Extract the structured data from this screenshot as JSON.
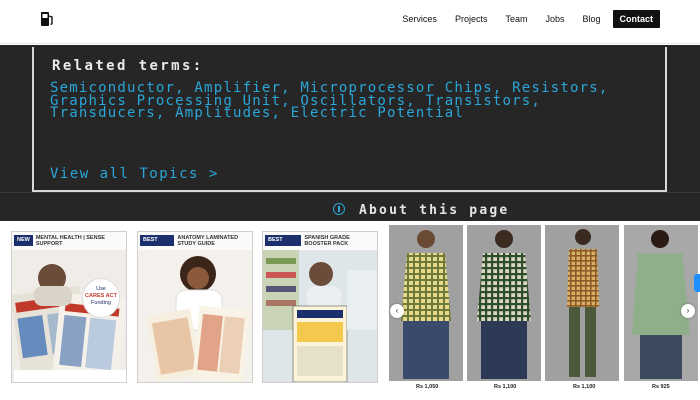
{
  "header": {
    "logo_icon": "fuel-pump-icon",
    "nav": [
      {
        "label": "Services"
      },
      {
        "label": "Projects"
      },
      {
        "label": "Team"
      },
      {
        "label": "Jobs"
      },
      {
        "label": "Blog"
      }
    ],
    "contact_label": "Contact"
  },
  "related": {
    "title": "Related terms:",
    "terms": "Semiconductor, Amplifier, Microprocessor Chips, Resistors, Graphics Processing Unit, Oscillators, Transistors, Transducers, Amplitudes, Electric Potential",
    "view_all": "View all Topics  >",
    "about": "About this page",
    "link_color": "#2aa6d8"
  },
  "products": {
    "books": [
      {
        "badge": "NEW",
        "subtitle": "MENTAL HEALTH | SENSE SUPPORT",
        "callout_line1": "Use",
        "callout_line2": "CARES ACT",
        "callout_line3": "Funding"
      },
      {
        "badge": "BEST SELLER",
        "subtitle": "ANATOMY LAMINATED STUDY GUIDE"
      },
      {
        "badge": "BEST SELLER",
        "subtitle": "SPANISH GRADE BOOSTER PACK"
      }
    ],
    "shirts": [
      {
        "price": "Rs 1,050"
      },
      {
        "price": "Rs 1,100"
      },
      {
        "price": "Rs 1,100"
      },
      {
        "price": "Rs 925"
      }
    ],
    "prev_label": "‹",
    "next_label": "›"
  }
}
